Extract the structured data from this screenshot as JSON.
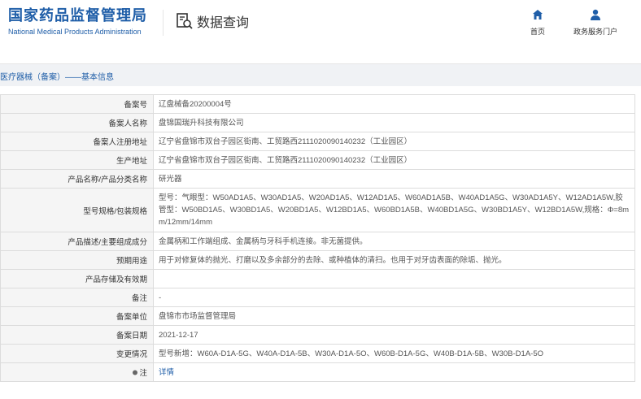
{
  "header": {
    "logo_cn": "国家药品监督管理局",
    "logo_en": "National Medical Products Administration",
    "section_title": "数据查询",
    "nav": {
      "home_label": "首页",
      "service_label": "政务服务门户"
    }
  },
  "breadcrumb": "医疗器械（备案）——基本信息",
  "colors": {
    "brand_blue": "#1f5ea8",
    "label_bg": "#f5f5f5",
    "band_bg": "#f0f2f5"
  },
  "record": [
    {
      "label": "备案号",
      "value": "辽盘械备20200004号"
    },
    {
      "label": "备案人名称",
      "value": "盘锦国瑞升科技有限公司"
    },
    {
      "label": "备案人注册地址",
      "value": "辽宁省盘锦市双台子园区街南、工贸路西2111020090140232（工业园区）"
    },
    {
      "label": "生产地址",
      "value": "辽宁省盘锦市双台子园区街南、工贸路西2111020090140232（工业园区）"
    },
    {
      "label": "产品名称/产品分类名称",
      "value": "研光器"
    },
    {
      "label": "型号规格/包装规格",
      "value": "型号：气眼型：W50AD1A5、W30AD1A5、W20AD1A5、W12AD1A5、W60AD1A5B、W40AD1A5G、W30AD1A5Y、W12AD1A5W,胶管型：W50BD1A5、W30BD1A5、W20BD1A5、W12BD1A5、W60BD1A5B、W40BD1A5G、W30BD1A5Y、W12BD1A5W,规格：Φ=8mm/12mm/14mm"
    },
    {
      "label": "产品描述/主要组成成分",
      "value": "金属柄和工作端组成、金属柄与牙科手机连接。非无菌提供。"
    },
    {
      "label": "预期用途",
      "value": "用于对修复体的抛光、打磨以及多余部分的去除、或种植体的清扫。也用于对牙齿表面的除垢、抛光。"
    },
    {
      "label": "产品存储及有效期",
      "value": ""
    },
    {
      "label": "备注",
      "value": "-"
    },
    {
      "label": "备案单位",
      "value": "盘锦市市场监督管理局"
    },
    {
      "label": "备案日期",
      "value": "2021-12-17"
    },
    {
      "label": "变更情况",
      "value": "型号新增：W60A-D1A-5G、W40A-D1A-5B、W30A-D1A-5O、W60B-D1A-5G、W40B-D1A-5B、W30B-D1A-5O"
    }
  ],
  "note_row": {
    "label": "注",
    "link": "详情"
  }
}
